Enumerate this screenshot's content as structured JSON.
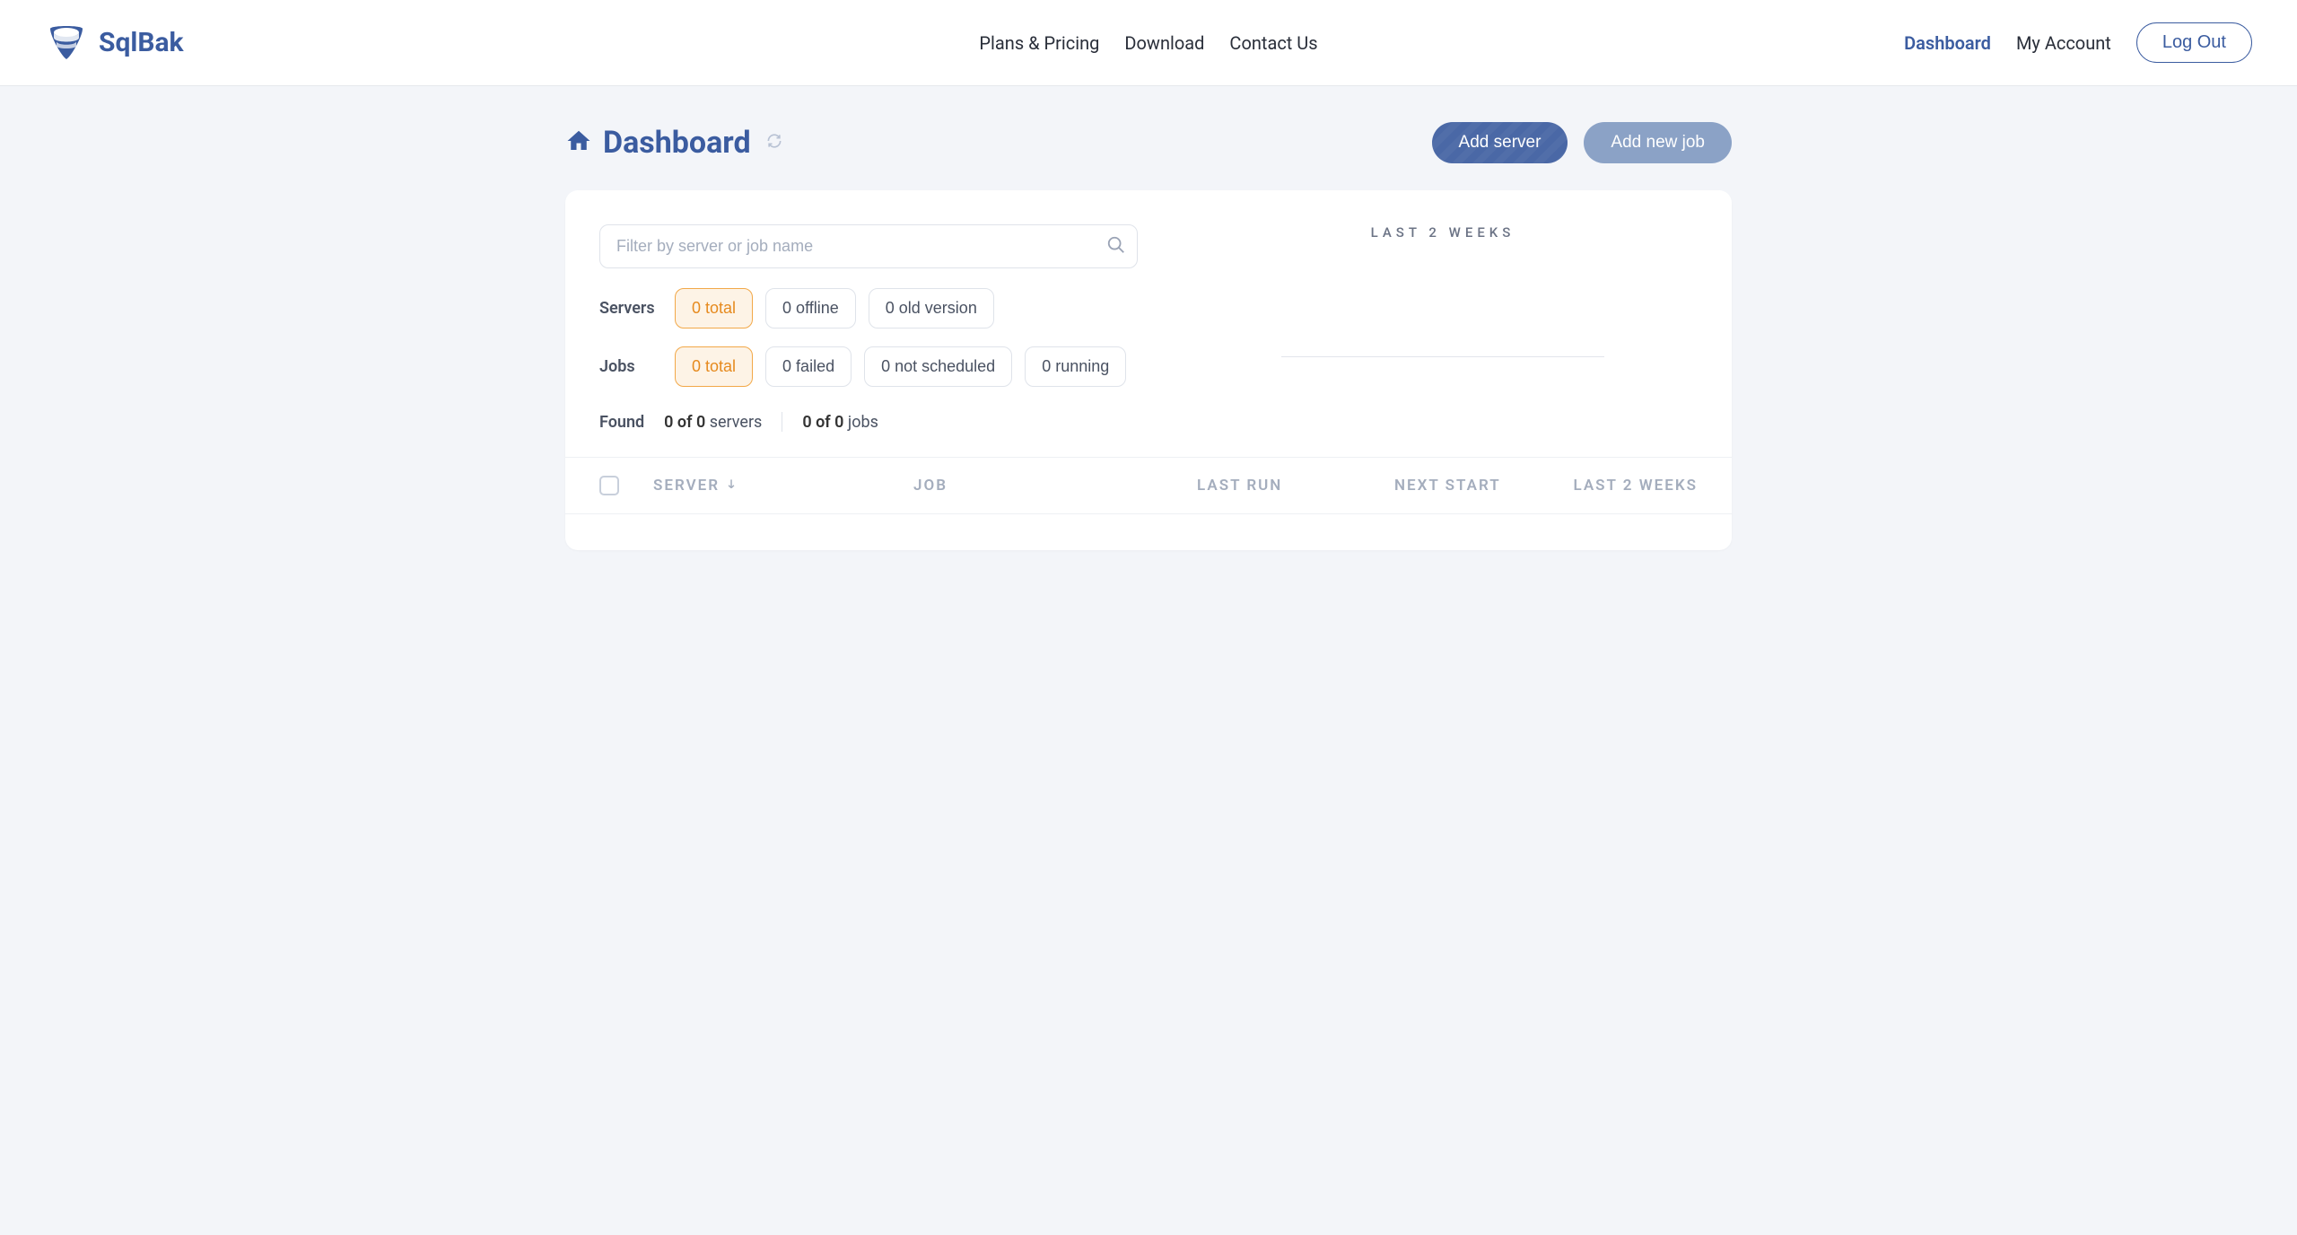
{
  "brand": {
    "name": "SqlBak"
  },
  "nav": {
    "center": {
      "plans": "Plans & Pricing",
      "download": "Download",
      "contact": "Contact Us"
    },
    "right": {
      "dashboard": "Dashboard",
      "account": "My Account",
      "logout": "Log Out"
    }
  },
  "page": {
    "title": "Dashboard"
  },
  "actions": {
    "add_server": "Add server",
    "add_job": "Add new job"
  },
  "search": {
    "placeholder": "Filter by server or job name"
  },
  "filters": {
    "servers_label": "Servers",
    "servers": {
      "total": "0 total",
      "offline": "0 offline",
      "old": "0 old version"
    },
    "jobs_label": "Jobs",
    "jobs": {
      "total": "0 total",
      "failed": "0 failed",
      "notscheduled": "0 not scheduled",
      "running": "0 running"
    }
  },
  "found": {
    "label": "Found",
    "servers_count": "0 of 0",
    "servers_suffix": " servers",
    "jobs_count": "0 of 0",
    "jobs_suffix": " jobs"
  },
  "sidechart": {
    "title": "LAST 2 WEEKS"
  },
  "table": {
    "headers": {
      "server": "SERVER",
      "job": "JOB",
      "last_run": "LAST RUN",
      "next_start": "NEXT START",
      "last_weeks": "LAST 2 WEEKS"
    }
  }
}
